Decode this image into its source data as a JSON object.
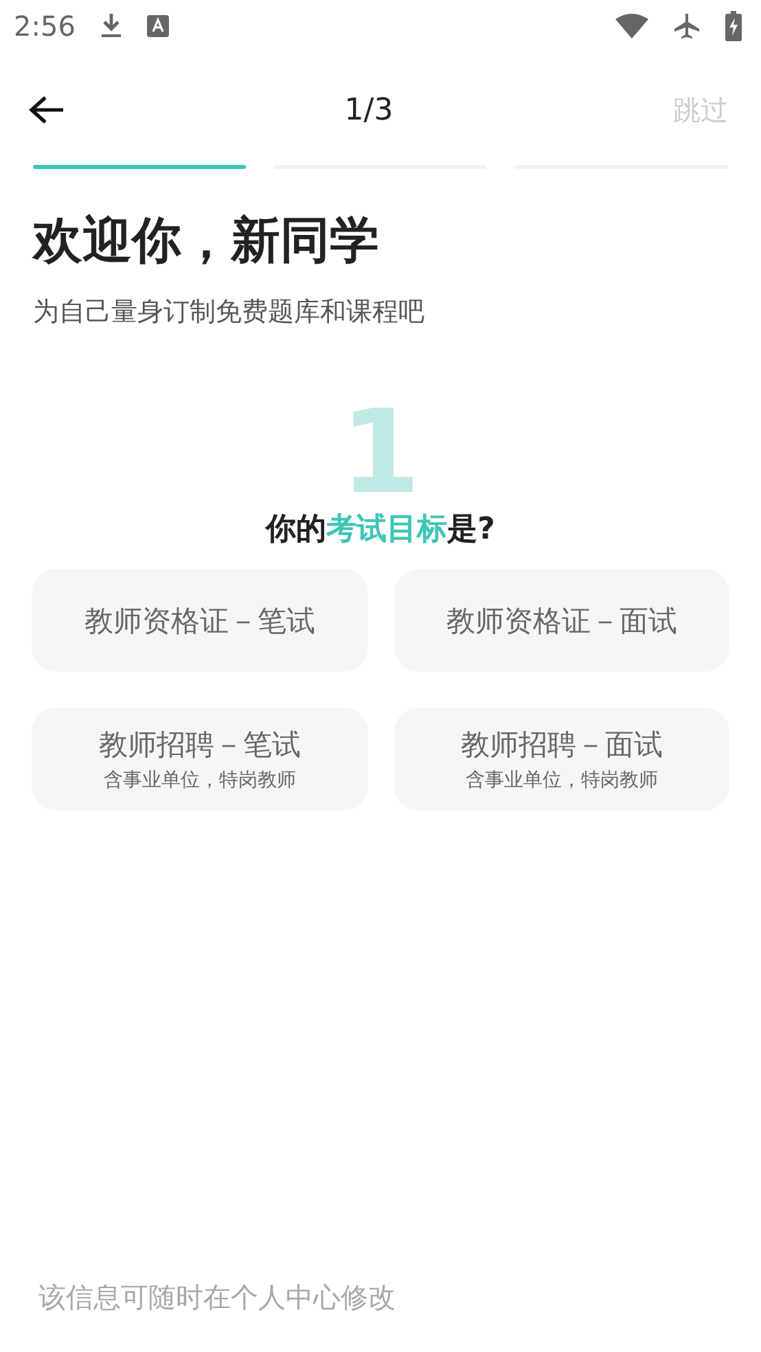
{
  "status_bar": {
    "time": "2:56"
  },
  "nav": {
    "page_indicator": "1/3",
    "skip": "跳过"
  },
  "progress": [
    {
      "selected": true
    },
    {
      "selected": false
    },
    {
      "selected": false
    }
  ],
  "heading": {
    "title": "欢迎你，新同学",
    "subtitle": "为自己量身订制免费题库和课程吧"
  },
  "question": {
    "step_number": "1",
    "before": "你的",
    "highlight": "考试目标",
    "after": "是?"
  },
  "options": [
    {
      "label": "教师资格证－笔试"
    },
    {
      "label": "教师资格证－面试"
    },
    {
      "label": "教师招聘－笔试",
      "note": "含事业单位，特岗教师"
    },
    {
      "label": "教师招聘－面试",
      "note": "含事业单位，特岗教师"
    }
  ],
  "footer_note": "该信息可随时在个人中心修改"
}
